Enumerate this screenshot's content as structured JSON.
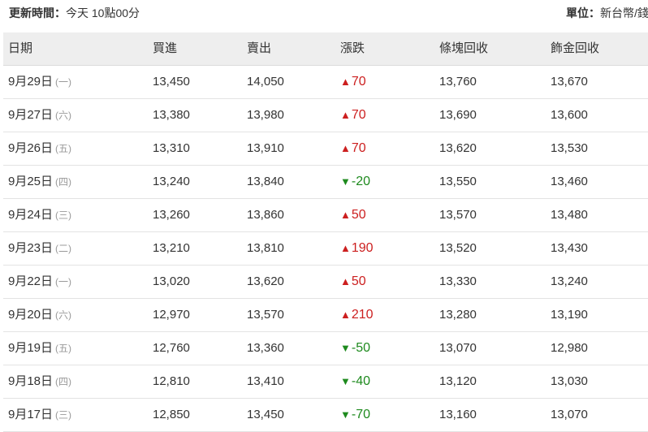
{
  "header": {
    "updated_label": "更新時間：",
    "updated_value": "今天 10點00分",
    "unit_label": "單位：",
    "unit_value": "新台幣/錢"
  },
  "table": {
    "columns": [
      "日期",
      "買進",
      "賣出",
      "漲跌",
      "條塊回收",
      "飾金回收"
    ],
    "rows": [
      {
        "date": "9月29日",
        "dow": "(一)",
        "buy": "13,450",
        "sell": "14,050",
        "dir": "up",
        "change": "70",
        "bar": "13,760",
        "jewelry": "13,670"
      },
      {
        "date": "9月27日",
        "dow": "(六)",
        "buy": "13,380",
        "sell": "13,980",
        "dir": "up",
        "change": "70",
        "bar": "13,690",
        "jewelry": "13,600"
      },
      {
        "date": "9月26日",
        "dow": "(五)",
        "buy": "13,310",
        "sell": "13,910",
        "dir": "up",
        "change": "70",
        "bar": "13,620",
        "jewelry": "13,530"
      },
      {
        "date": "9月25日",
        "dow": "(四)",
        "buy": "13,240",
        "sell": "13,840",
        "dir": "down",
        "change": "-20",
        "bar": "13,550",
        "jewelry": "13,460"
      },
      {
        "date": "9月24日",
        "dow": "(三)",
        "buy": "13,260",
        "sell": "13,860",
        "dir": "up",
        "change": "50",
        "bar": "13,570",
        "jewelry": "13,480"
      },
      {
        "date": "9月23日",
        "dow": "(二)",
        "buy": "13,210",
        "sell": "13,810",
        "dir": "up",
        "change": "190",
        "bar": "13,520",
        "jewelry": "13,430"
      },
      {
        "date": "9月22日",
        "dow": "(一)",
        "buy": "13,020",
        "sell": "13,620",
        "dir": "up",
        "change": "50",
        "bar": "13,330",
        "jewelry": "13,240"
      },
      {
        "date": "9月20日",
        "dow": "(六)",
        "buy": "12,970",
        "sell": "13,570",
        "dir": "up",
        "change": "210",
        "bar": "13,280",
        "jewelry": "13,190"
      },
      {
        "date": "9月19日",
        "dow": "(五)",
        "buy": "12,760",
        "sell": "13,360",
        "dir": "down",
        "change": "-50",
        "bar": "13,070",
        "jewelry": "12,980"
      },
      {
        "date": "9月18日",
        "dow": "(四)",
        "buy": "12,810",
        "sell": "13,410",
        "dir": "down",
        "change": "-40",
        "bar": "13,120",
        "jewelry": "13,030"
      },
      {
        "date": "9月17日",
        "dow": "(三)",
        "buy": "12,850",
        "sell": "13,450",
        "dir": "down",
        "change": "-70",
        "bar": "13,160",
        "jewelry": "13,070"
      }
    ]
  },
  "colors": {
    "up": "#cc1f1f",
    "down": "#1e8a1e"
  },
  "icons": {
    "up": "triangle-up-icon",
    "down": "triangle-down-icon"
  }
}
